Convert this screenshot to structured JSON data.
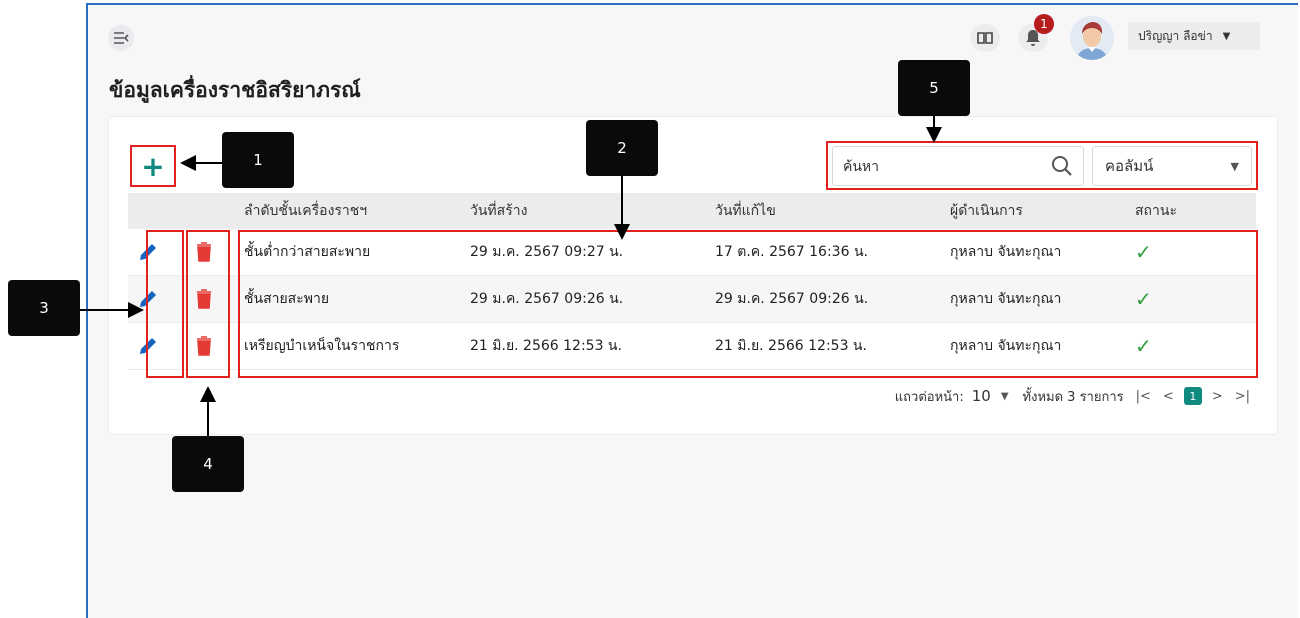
{
  "header": {
    "page_title": "ข้อมูลเครื่องราชอิสริยาภรณ์",
    "notification_count": "1",
    "user_name": "ปริญญา ลือข่า"
  },
  "toolbar": {
    "add_label": "+",
    "search_placeholder": "ค้นหา",
    "column_select_label": "คอลัมน์"
  },
  "table": {
    "columns": [
      "ลำดับชั้นเครื่องราชฯ",
      "วันที่สร้าง",
      "วันที่แก้ไข",
      "ผู้ดำเนินการ",
      "สถานะ"
    ],
    "rows": [
      {
        "name": "ชั้นต่ำกว่าสายสะพาย",
        "created": "29 ม.ค. 2567 09:27 น.",
        "updated": "17 ต.ค. 2567 16:36 น.",
        "user": "กุหลาบ จันทะกุณา",
        "status": "✓"
      },
      {
        "name": "ชั้นสายสะพาย",
        "created": "29 ม.ค. 2567 09:26 น.",
        "updated": "29 ม.ค. 2567 09:26 น.",
        "user": "กุหลาบ จันทะกุณา",
        "status": "✓"
      },
      {
        "name": "เหรียญบำเหน็จในราชการ",
        "created": "21 มิ.ย. 2566 12:53 น.",
        "updated": "21 มิ.ย. 2566 12:53 น.",
        "user": "กุหลาบ จันทะกุณา",
        "status": "✓"
      }
    ]
  },
  "pagination": {
    "rows_per_page_label": "แถวต่อหน้า:",
    "rows_per_page_value": "10",
    "total_label": "ทั้งหมด 3 รายการ",
    "first": "|<",
    "prev": "<",
    "current_page": "1",
    "next": ">",
    "last": ">|"
  },
  "callouts": {
    "c1": "1",
    "c2": "2",
    "c3": "3",
    "c4": "4",
    "c5": "5"
  },
  "colors": {
    "accent": "#0f8a7e",
    "delete": "#e53935",
    "edit": "#1565c0",
    "highlight": "#e32020",
    "status_ok": "#2e9e3e"
  }
}
